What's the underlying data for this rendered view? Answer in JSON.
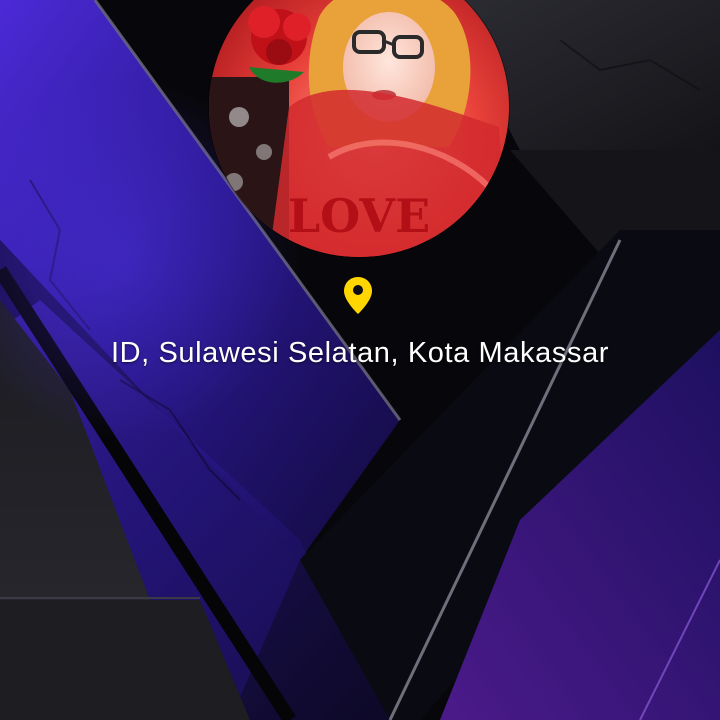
{
  "profile": {
    "avatar_icon": "user-photo-avatar",
    "location_icon": "location-pin-icon",
    "location_icon_color": "#FFD600",
    "location_text": "ID, Sulawesi Selatan, Kota Makassar"
  },
  "theme": {
    "accent_purple": "#3a1fb8",
    "background_dark": "#08080c"
  }
}
